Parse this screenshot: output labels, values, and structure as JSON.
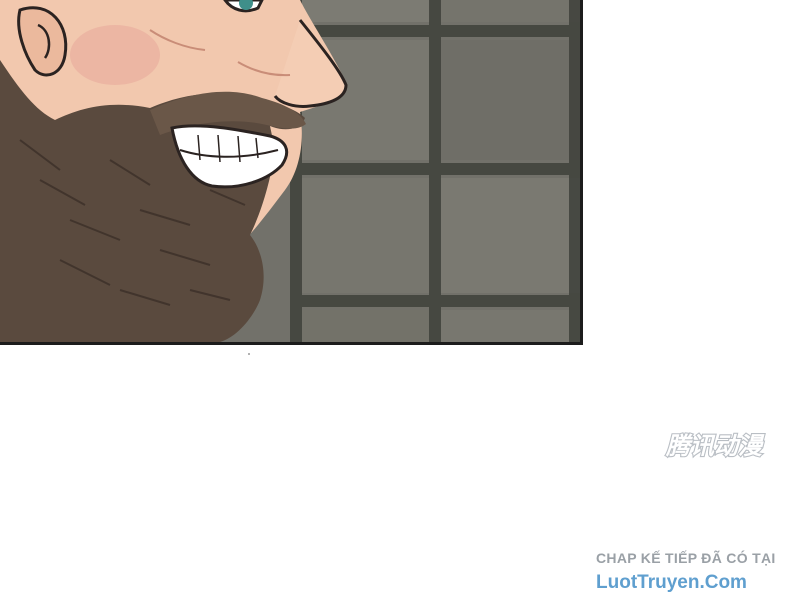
{
  "panel": {
    "illustration": "bearded-man-grinning-icon",
    "background": "stone-wall-tiles"
  },
  "watermark": {
    "logo_text": "腾讯动漫"
  },
  "footer": {
    "next_chapter_text": "CHAP KẾ TIẾP ĐÃ CÓ TẠI",
    "site_name": "LuotTruyen.Com"
  },
  "colors": {
    "panel_border": "#1c1c1c",
    "wall": "#6f6e66",
    "grout": "#3f413b",
    "skin": "#f2c8ae",
    "beard": "#5a4a3e",
    "caption_grey": "#9aa0a6",
    "link_blue": "#5f9fcf"
  }
}
